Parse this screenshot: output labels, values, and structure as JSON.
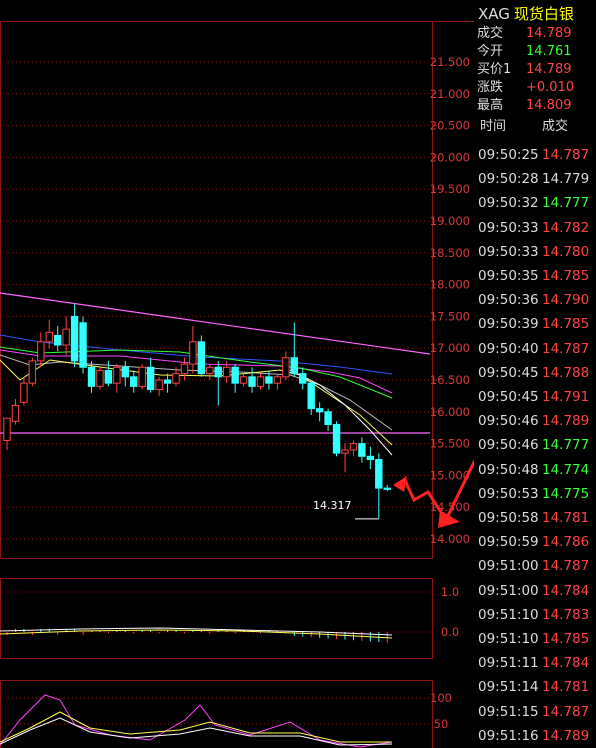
{
  "chart": {
    "price_ticks": [
      "21.500",
      "21.000",
      "20.500",
      "20.000",
      "19.500",
      "19.000",
      "18.500",
      "18.000",
      "17.500",
      "17.000",
      "16.500",
      "16.000",
      "15.500",
      "15.000",
      "14.500",
      "14.000"
    ],
    "low_label": "14.317",
    "macd_ticks": [
      "1.0",
      "0.0"
    ],
    "kdj_ticks": [
      "100",
      "50"
    ]
  },
  "quote": {
    "symbol": "XAG",
    "name": "现货白银",
    "rows": [
      {
        "label": "成交",
        "value": "14.789",
        "color": "#ff4444"
      },
      {
        "label": "今开",
        "value": "14.761",
        "color": "#33ff33"
      },
      {
        "label": "买价1",
        "value": "14.789",
        "color": "#ff4444"
      },
      {
        "label": "涨跌",
        "value": "+0.010",
        "color": "#ff4444"
      },
      {
        "label": "最高",
        "value": "14.809",
        "color": "#ff4444"
      }
    ]
  },
  "ticks": {
    "header_time": "时间",
    "header_price": "成交",
    "rows": [
      {
        "time": "09:50:25",
        "price": "14.787",
        "color": "#ff4444"
      },
      {
        "time": "09:50:28",
        "price": "14.779",
        "color": "#dcdcdc"
      },
      {
        "time": "09:50:32",
        "price": "14.777",
        "color": "#33ff33"
      },
      {
        "time": "09:50:33",
        "price": "14.782",
        "color": "#ff4444"
      },
      {
        "time": "09:50:33",
        "price": "14.780",
        "color": "#ff4444"
      },
      {
        "time": "09:50:35",
        "price": "14.785",
        "color": "#ff4444"
      },
      {
        "time": "09:50:36",
        "price": "14.790",
        "color": "#ff4444"
      },
      {
        "time": "09:50:39",
        "price": "14.785",
        "color": "#ff4444"
      },
      {
        "time": "09:50:40",
        "price": "14.787",
        "color": "#ff4444"
      },
      {
        "time": "09:50:45",
        "price": "14.788",
        "color": "#ff4444"
      },
      {
        "time": "09:50:45",
        "price": "14.791",
        "color": "#ff4444"
      },
      {
        "time": "09:50:46",
        "price": "14.789",
        "color": "#ff4444"
      },
      {
        "time": "09:50:46",
        "price": "14.777",
        "color": "#33ff33"
      },
      {
        "time": "09:50:48",
        "price": "14.774",
        "color": "#33ff33"
      },
      {
        "time": "09:50:53",
        "price": "14.775",
        "color": "#33ff33"
      },
      {
        "time": "09:50:58",
        "price": "14.781",
        "color": "#ff4444"
      },
      {
        "time": "09:50:59",
        "price": "14.786",
        "color": "#ff4444"
      },
      {
        "time": "09:51:00",
        "price": "14.787",
        "color": "#ff4444"
      },
      {
        "time": "09:51:00",
        "price": "14.784",
        "color": "#ff4444"
      },
      {
        "time": "09:51:10",
        "price": "14.783",
        "color": "#ff4444"
      },
      {
        "time": "09:51:10",
        "price": "14.785",
        "color": "#ff4444"
      },
      {
        "time": "09:51:11",
        "price": "14.784",
        "color": "#ff4444"
      },
      {
        "time": "09:51:14",
        "price": "14.781",
        "color": "#ff4444"
      },
      {
        "time": "09:51:15",
        "price": "14.787",
        "color": "#ff4444"
      },
      {
        "time": "09:51:16",
        "price": "14.789",
        "color": "#ff4444"
      }
    ]
  },
  "colors": {
    "up": "#ff4444",
    "down": "#33ff33",
    "grid": "#8a1515",
    "cyan": "#33ffff",
    "trendline": "#ff66ff",
    "annotation_arrow": "#ff2020"
  }
}
